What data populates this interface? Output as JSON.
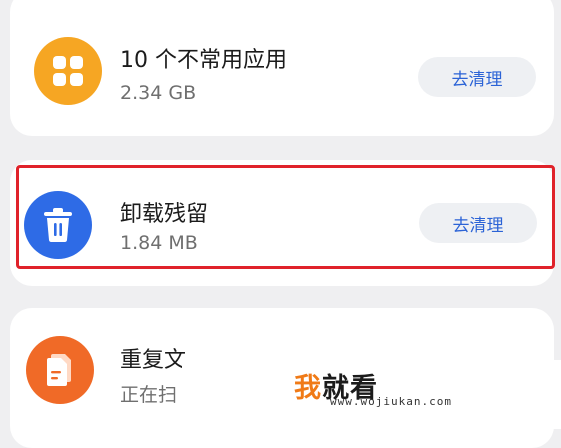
{
  "items": [
    {
      "title": "10 个不常用应用",
      "subtitle": "2.34 GB",
      "action": "去清理",
      "icon": "apps-grid-icon",
      "icon_color": "#f6a623"
    },
    {
      "title": "卸载残留",
      "subtitle": "1.84 MB",
      "action": "去清理",
      "icon": "trash-icon",
      "icon_color": "#2e6be6"
    },
    {
      "title": "重复文",
      "subtitle": "正在扫",
      "icon": "document-icon",
      "icon_color": "#f06a27"
    }
  ],
  "watermark": {
    "first_char": "我",
    "rest": "就看",
    "url": "www.wojiukan.com"
  },
  "colors": {
    "highlight": "#e0222a",
    "button_text": "#2b63d6",
    "background": "#efeff1"
  }
}
